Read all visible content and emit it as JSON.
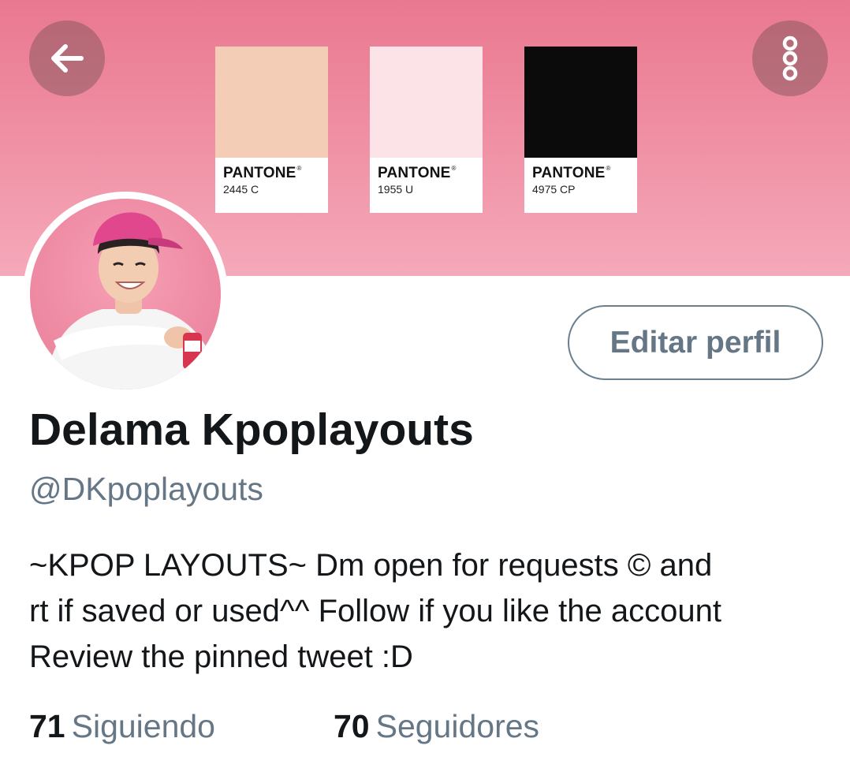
{
  "banner": {
    "swatches": [
      {
        "brand": "PANTONE",
        "code": "2445 C",
        "color": "#f4cdb7"
      },
      {
        "brand": "PANTONE",
        "code": "1955 U",
        "color": "#fbe3e8"
      },
      {
        "brand": "PANTONE",
        "code": "4975 CP",
        "color": "#0b0b0c"
      }
    ]
  },
  "header": {
    "back_icon": "arrow-left-icon",
    "menu_icon": "more-vertical-icon"
  },
  "profile": {
    "edit_button_label": "Editar perfil",
    "display_name": "Delama Kpoplayouts",
    "handle": "@DKpoplayouts",
    "bio_lines": [
      "~KPOP LAYOUTS~ Dm open for requests  © and",
      "rt if saved or used^^ Follow if you like the account",
      "Review the pinned tweet :D"
    ],
    "following_count": "71",
    "following_label": "Siguiendo",
    "followers_count": "70",
    "followers_label": "Seguidores"
  },
  "colors": {
    "banner_pink": "#ef8da2",
    "secondary_text": "#657786",
    "primary_text": "#14171a"
  }
}
